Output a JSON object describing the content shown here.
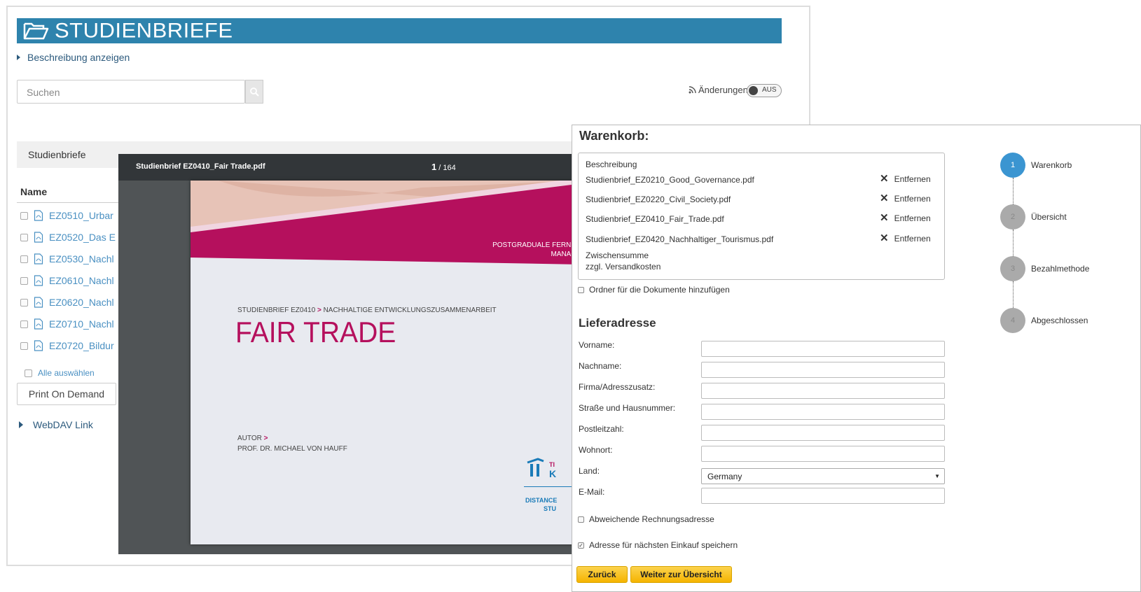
{
  "header": {
    "title": "STUDIENBRIEFE",
    "description_toggle": "Beschreibung anzeigen"
  },
  "search": {
    "placeholder": "Suchen"
  },
  "changes": {
    "label": "Änderungen",
    "toggle_state": "AUS"
  },
  "tab": {
    "label": "Studienbriefe"
  },
  "file_list": {
    "column_name": "Name",
    "items": [
      "EZ0510_Urbar",
      "EZ0520_Das E",
      "EZ0530_Nachl",
      "EZ0610_Nachl",
      "EZ0620_Nachl",
      "EZ0710_Nachl",
      "EZ0720_Bildur"
    ],
    "select_all": "Alle auswählen",
    "print_on_demand": "Print On Demand",
    "webdav": "WebDAV Link"
  },
  "viewer": {
    "filename": "Studienbrief EZ0410_Fair Trade.pdf",
    "page_current": "1",
    "page_total": "164",
    "page": {
      "header_line1": "POSTGRADUALE FERNSTUDIE",
      "header_line2": "MANAGEMEN",
      "subtitle": "STUDIENBRIEF EZ0410",
      "subtitle_rest": "NACHHALTIGE ENTWICKLUNGSZUSAMMENARBEIT",
      "title": "FAIR TRADE",
      "author_label": "AUTOR",
      "author_name": "PROF. DR. MICHAEL VON HAUFF",
      "logo_text1": "TI",
      "logo_text2": "K",
      "distance_line1": "DISTANCE",
      "distance_line2": "STU"
    }
  },
  "cart": {
    "title": "Warenkorb:",
    "description_header": "Beschreibung",
    "items": [
      {
        "name": "Studienbrief_EZ0210_Good_Governance.pdf",
        "action": "Entfernen"
      },
      {
        "name": "Studienbrief_EZ0220_Civil_Society.pdf",
        "action": "Entfernen"
      },
      {
        "name": "Studienbrief_EZ0410_Fair_Trade.pdf",
        "action": "Entfernen"
      },
      {
        "name": "Studienbrief_EZ0420_Nachhaltiger_Tourismus.pdf",
        "action": "Entfernen"
      }
    ],
    "subtotal": "Zwischensumme",
    "shipping": "zzgl. Versandkosten",
    "folder_option": "Ordner für die Dokumente hinzufügen"
  },
  "address": {
    "title": "Lieferadresse",
    "fields": {
      "vorname": "Vorname:",
      "nachname": "Nachname:",
      "firma": "Firma/Adresszusatz:",
      "strasse": "Straße und Hausnummer:",
      "plz": "Postleitzahl:",
      "wohnort": "Wohnort:",
      "land": "Land:",
      "email": "E-Mail:"
    },
    "land_value": "Germany",
    "alt_billing": "Abweichende Rechnungsadresse",
    "save_address": "Adresse für nächsten Einkauf speichern"
  },
  "buttons": {
    "back": "Zurück",
    "next": "Weiter zur Übersicht"
  },
  "steps": [
    {
      "num": "1",
      "label": "Warenkorb"
    },
    {
      "num": "2",
      "label": "Übersicht"
    },
    {
      "num": "3",
      "label": "Bezahlmethode"
    },
    {
      "num": "4",
      "label": "Abgeschlossen"
    }
  ],
  "colors": {
    "banner": "#2e83ad",
    "accent_magenta": "#b5105d",
    "step_active": "#3b95d1",
    "button_yellow": "#f5b400"
  }
}
